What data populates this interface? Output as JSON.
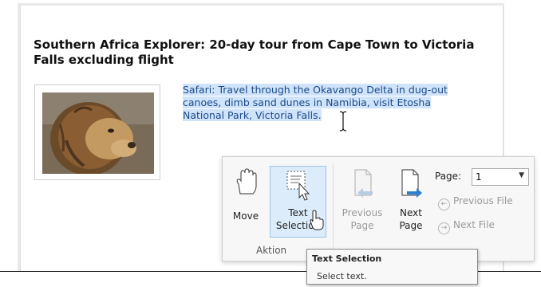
{
  "document": {
    "title": "Southern Africa Explorer: 20-day tour from Cape Town to Victoria Falls excluding flight",
    "description_lines": [
      "Safari: Travel through the Okavango Delta in dug-out",
      "canoes, dimb sand dunes in Namibia, visit Etosha",
      "National Park, Victoria Falls."
    ],
    "image_icon": "lion-photo"
  },
  "ribbon": {
    "action_group": {
      "label": "Aktion",
      "move_label": "Move",
      "move_icon": "hand-icon",
      "text_selection_label_1": "Text",
      "text_selection_label_2": "Selection",
      "text_selection_icon": "text-selection-icon"
    },
    "navigation_group": {
      "previous_page_1": "Previous",
      "previous_page_2": "Page",
      "next_page_1": "Next",
      "next_page_2": "Page",
      "page_label": "Page:",
      "page_value": "1",
      "previous_file": "Previous File",
      "next_file": "Next File"
    }
  },
  "tooltip": {
    "title": "Text Selection",
    "body": "Select text."
  },
  "colors": {
    "selection_highlight": "#cfe3fb",
    "selected_button_bg": "#dcecfb",
    "selected_text": "#1c4a8a"
  }
}
